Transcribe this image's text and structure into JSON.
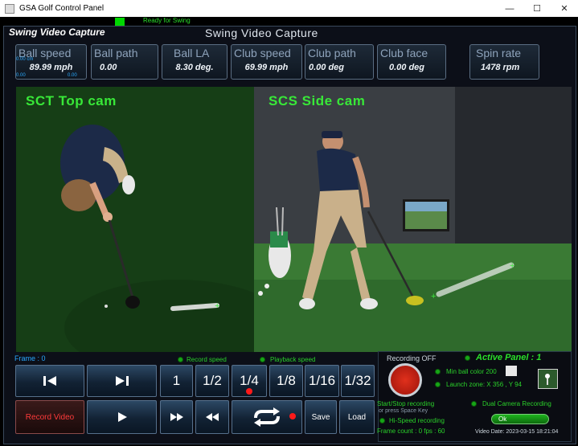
{
  "window": {
    "title": "GSA Golf Control Panel",
    "controls": {
      "minimize": "—",
      "maximize": "☐",
      "close": "✕"
    }
  },
  "status": {
    "text": "Ready for Swing",
    "led_color": "#00d800"
  },
  "panel": {
    "label": "Swing Video Capture",
    "heading": "Swing Video Capture"
  },
  "metrics": [
    {
      "label": "Ball speed",
      "value": "89.99 mph"
    },
    {
      "label": "Ball path",
      "value": "0.00"
    },
    {
      "label": "Ball LA",
      "value": "8.30 deg."
    },
    {
      "label": "Club speed",
      "value": "69.99 mph"
    },
    {
      "label": "Club path",
      "value": "0.00 deg"
    },
    {
      "label": "Club face",
      "value": "0.00 deg"
    },
    {
      "label": "Spin rate",
      "value": "1478 rpm"
    }
  ],
  "metric_micro": {
    "cm": "0.00 cm",
    "left": "0.00",
    "right": "0.00"
  },
  "cameras": {
    "top": "SCT Top cam",
    "side": "SCS Side cam"
  },
  "playback": {
    "frame_label": "Frame : 0",
    "record_speed": "Record speed",
    "playback_speed": "Playback speed",
    "speeds": [
      "1",
      "1/2",
      "1/4",
      "1/8",
      "1/16",
      "1/32"
    ],
    "selected_speed": "1/4",
    "record_video": "Record Video",
    "save": "Save",
    "load": "Load"
  },
  "recording": {
    "status": "Recording OFF",
    "active_panel": "Active Panel : 1",
    "min_ball_color": "Min ball color 200",
    "launch_zone": "Launch zone: X 356 , Y 94",
    "start_stop": "Start/Stop recording",
    "or_press": "or press Space Key",
    "hi_speed": "Hi-Speed recording",
    "dual_camera": "Dual Camera Recording",
    "ok": "Ok",
    "frame_count": "Frame count : 0 fps : 60",
    "video_date": "Video Date: 2023-03-15 18:21:04"
  },
  "colors": {
    "accent_green": "#2ae02a",
    "label_blue": "#2aa8ff",
    "record_red": "#d02a1a"
  }
}
